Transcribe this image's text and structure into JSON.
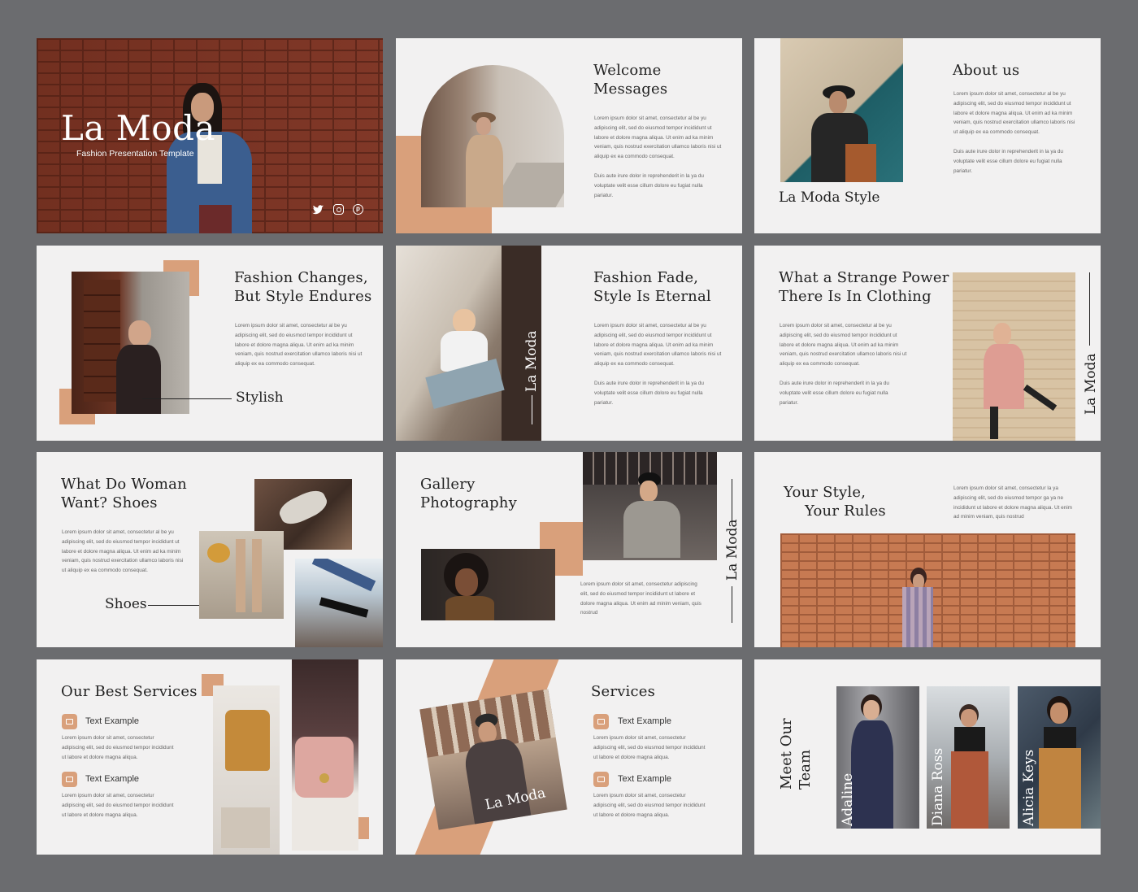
{
  "slide1": {
    "title": "La Moda",
    "subtitle": "Fashion Presentation Template",
    "social_icons": [
      "twitter-icon",
      "instagram-icon",
      "pinterest-icon"
    ]
  },
  "slide2": {
    "title": "Welcome\nMessages",
    "p1": "Lorem ipsum dolor sit amet, consectetur al be yu adipiscing elit, sed do eiusmod tempor incididunt ut labore et dolore magna aliqua. Ut enim ad ka minim veniam, quis nostrud exercitation ullamco laboris nisi ut aliquip ex ea commodo consequat.",
    "p2": "Duis aute irure dolor in reprehenderit in la ya du voluptate velit esse cillum dolore eu fugiat nulla pariatur."
  },
  "slide3": {
    "title": "About us",
    "caption": "La Moda Style",
    "p1": "Lorem ipsum dolor sit amet, consectetur al be yu adipiscing elit, sed do eiusmod tempor incididunt ut labore et dolore magna aliqua. Ut enim ad ka minim veniam, quis nostrud exercitation ullamco laboris nisi ut aliquip ex ea commodo consequat.",
    "p2": "Duis aute irure dolor in reprehenderit in la ya du voluptate velit esse cillum dolore eu fugiat nulla pariatur."
  },
  "slide4": {
    "title": "Fashion Changes,\nBut Style Endures",
    "caption": "Stylish",
    "p1": "Lorem ipsum dolor sit amet, consectetur al be yu adipiscing elit, sed do eiusmod tempor incididunt ut labore et dolore magna aliqua. Ut enim ad ka minim veniam, quis nostrud exercitation ullamco laboris nisi ut aliquip ex ea commodo consequat."
  },
  "slide5": {
    "title": "Fashion Fade,\nStyle Is Eternal",
    "vertical": "La Moda",
    "p1": "Lorem ipsum dolor sit amet, consectetur al be yu adipiscing elit, sed do eiusmod tempor incididunt ut labore et dolore magna aliqua. Ut enim ad ka minim veniam, quis nostrud exercitation ullamco laboris nisi ut aliquip ex ea commodo consequat.",
    "p2": "Duis aute irure dolor in reprehenderit in la ya du voluptate velit esse cillum dolore eu fugiat nulla pariatur."
  },
  "slide6": {
    "title": "What a Strange Power\nThere Is In Clothing",
    "vertical": "La Moda",
    "p1": "Lorem ipsum dolor sit amet, consectetur al be yu adipiscing elit, sed do eiusmod tempor incididunt ut labore et dolore magna aliqua. Ut enim ad ka minim veniam, quis nostrud exercitation ullamco laboris nisi ut aliquip ex ea commodo consequat.",
    "p2": "Duis aute irure dolor in reprehenderit in la ya du voluptate velit esse cillum dolore eu fugiat nulla pariatur."
  },
  "slide7": {
    "title": "What Do Woman\nWant? Shoes",
    "caption": "Shoes",
    "p1": "Lorem ipsum dolor sit amet, consectetur al be yu adipiscing elit, sed do eiusmod tempor incididunt ut labore et dolore magna aliqua. Ut enim ad ka minim veniam, quis nostrud exercitation ullamco laboris nisi ut aliquip ex ea commodo consequat."
  },
  "slide8": {
    "title": "Gallery\nPhotography",
    "vertical": "La Moda",
    "p1": "Lorem ipsum dolor sit amet, consectetur adipiscing elit, sed do eiusmod tempor incididunt ut labore et dolore magna aliqua. Ut enim ad minim veniam, quis nostrud"
  },
  "slide9": {
    "title_line1": "Your Style,",
    "title_line2": "Your Rules",
    "p1": "Lorem ipsum dolor sit amet, consectetur la ya adipiscing elit, sed do eiusmod tempor ga ya ne incididunt ut labore et dolore magna aliqua. Ut enim ad minim veniam, quis nostrud"
  },
  "slide10": {
    "title": "Our Best Services",
    "items": [
      {
        "label": "Text Example",
        "text": "Lorem ipsum dolor sit amet, consectetur adipiscing elit, sed do eiusmod tempor incididunt ut labore et dolore magna aliqua."
      },
      {
        "label": "Text Example",
        "text": "Lorem ipsum dolor sit amet, consectetur adipiscing elit, sed do eiusmod tempor incididunt ut labore et dolore magna aliqua."
      }
    ]
  },
  "slide11": {
    "title": "Services",
    "photo_caption": "La Moda",
    "items": [
      {
        "label": "Text Example",
        "text": "Lorem ipsum dolor sit amet, consectetur adipiscing elit, sed do eiusmod tempor incididunt ut labore et dolore magna aliqua."
      },
      {
        "label": "Text Example",
        "text": "Lorem ipsum dolor sit amet, consectetur adipiscing elit, sed do eiusmod tempor incididunt ut labore et dolore magna aliqua."
      }
    ]
  },
  "slide12": {
    "title": "Meet Our\nTeam",
    "members": [
      "Adaline",
      "Diana Ross",
      "Alicia Keys"
    ]
  },
  "colors": {
    "background": "#6b6c6f",
    "slide": "#f2f1f1",
    "accent": "#d9a07b",
    "text": "#222222"
  }
}
